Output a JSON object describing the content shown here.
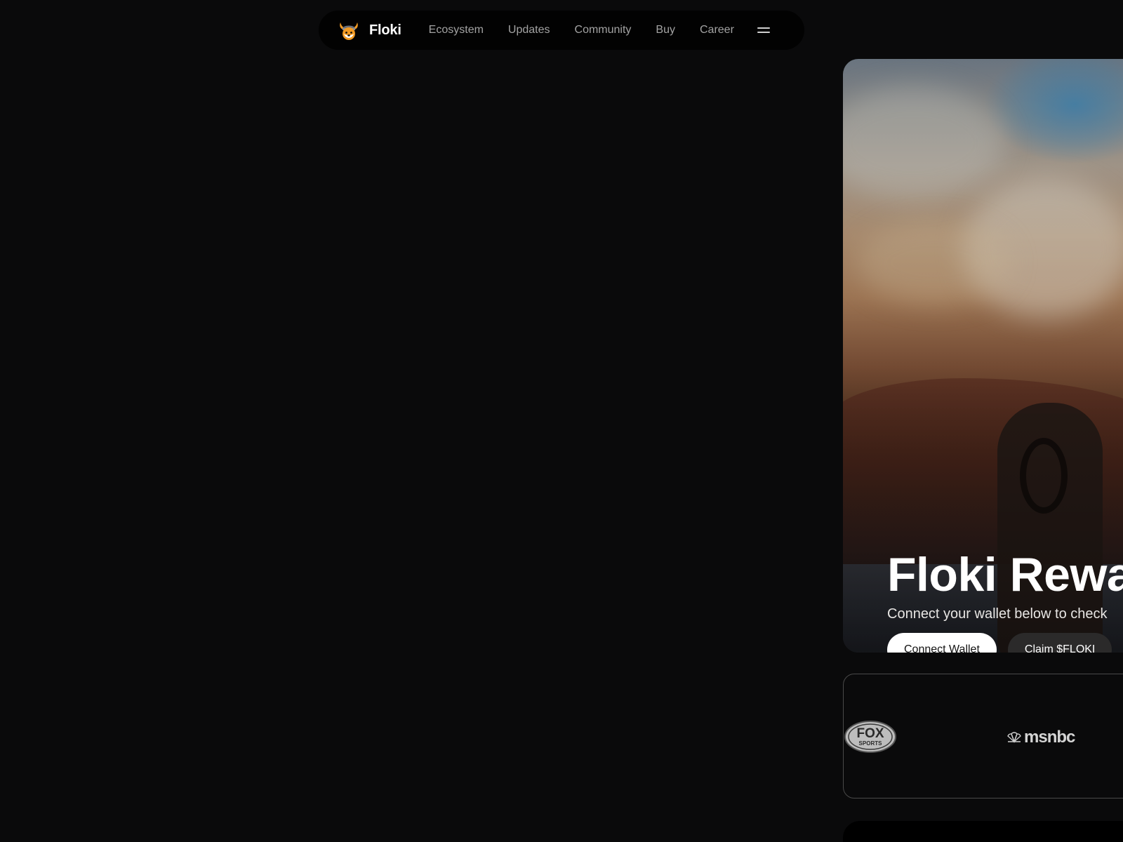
{
  "nav": {
    "brand": "Floki",
    "links": [
      "Ecosystem",
      "Updates",
      "Community",
      "Buy",
      "Career"
    ],
    "logo_icon": "floki-viking-dog-logo",
    "menu_icon": "hamburger-menu-icon"
  },
  "hero": {
    "title": "Floki Rewa",
    "subtitle": "Connect your wallet below to check",
    "buttons": {
      "connect": "Connect Wallet",
      "claim": "Claim $FLOKI"
    }
  },
  "press": {
    "logos": [
      {
        "name": "FOX",
        "sub": "SPORTS",
        "icon": "fox-sports-logo"
      },
      {
        "name": "msnbc",
        "icon": "msnbc-peacock-logo"
      }
    ]
  },
  "colors": {
    "background": "#0a0a0b",
    "nav_bg": "#020202",
    "nav_link": "#a3a3a3",
    "button_primary_bg": "#ffffff",
    "button_secondary_bg": "#2b2a2a"
  }
}
